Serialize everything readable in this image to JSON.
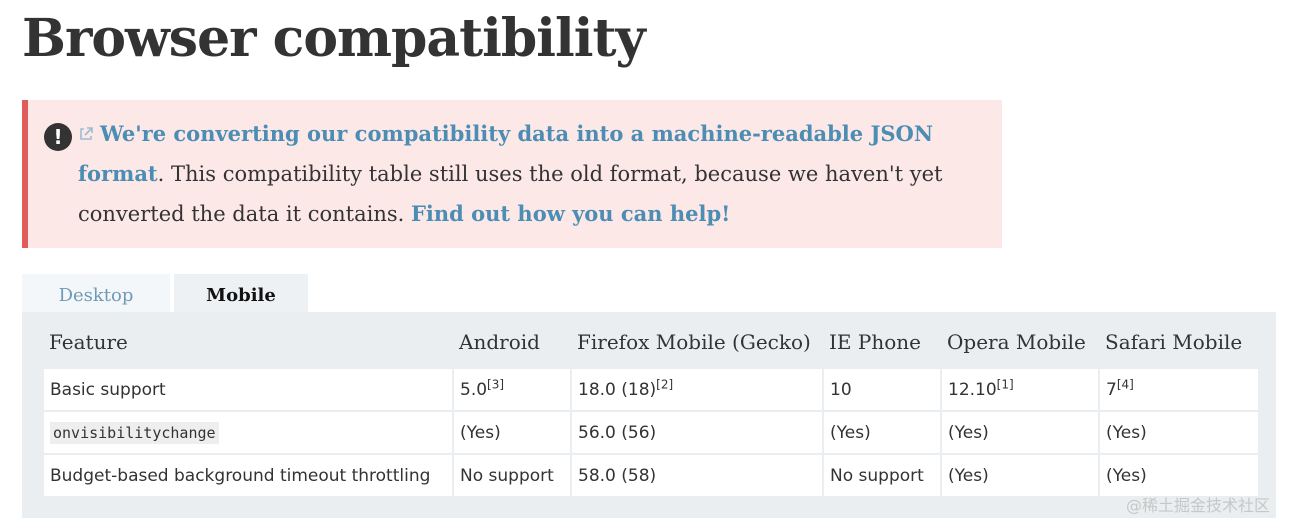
{
  "page": {
    "title": "Browser compatibility"
  },
  "notice": {
    "icon": "exclamation-circle-icon",
    "link_icon": "external-link-icon",
    "link1": "We're converting our compatibility data into a machine-readable JSON format",
    "text": ". This compatibility table still uses the old format, because we haven't yet converted the data it contains. ",
    "link2": "Find out how you can help!",
    "colors": {
      "background": "#fde8e8",
      "border": "#e05c5c",
      "link": "#4c8db3"
    }
  },
  "tabs": {
    "desktop": "Desktop",
    "mobile": "Mobile",
    "active": "Mobile"
  },
  "table": {
    "headers": [
      "Feature",
      "Android",
      "Firefox Mobile (Gecko)",
      "IE Phone",
      "Opera Mobile",
      "Safari Mobile"
    ],
    "rows": [
      {
        "feature": "Basic support",
        "android": "5.0",
        "android_note": "[3]",
        "firefox": "18.0 (18)",
        "firefox_note": "[2]",
        "ie": "10",
        "opera": "12.10",
        "opera_note": "[1]",
        "safari": "7",
        "safari_note": "[4]"
      },
      {
        "feature": "onvisibilitychange",
        "android": "(Yes)",
        "firefox": "56.0 (56)",
        "ie": "(Yes)",
        "opera": "(Yes)",
        "safari": "(Yes)"
      },
      {
        "feature": "Budget-based background timeout throttling",
        "android": "No support",
        "firefox": "58.0 (58)",
        "ie": "No support",
        "opera": "(Yes)",
        "safari": "(Yes)"
      }
    ],
    "colors": {
      "no_support": "#d14a08",
      "muted": "#999999"
    }
  },
  "watermark": "@稀土掘金技术社区"
}
